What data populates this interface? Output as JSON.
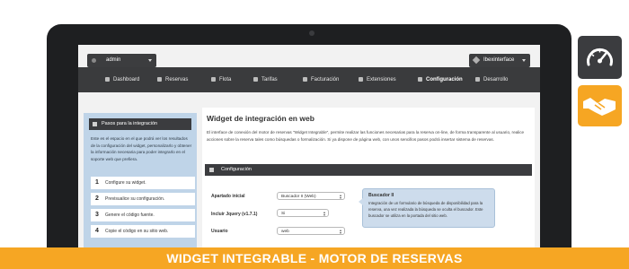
{
  "header": {
    "user_label": "admin",
    "account_label": "Ibexinterface"
  },
  "nav": {
    "items": [
      {
        "label": "Dashboard"
      },
      {
        "label": "Reservas"
      },
      {
        "label": "Flota"
      },
      {
        "label": "Tarifas"
      },
      {
        "label": "Facturación"
      },
      {
        "label": "Extensiones"
      },
      {
        "label": "Configuración"
      },
      {
        "label": "Desarrollo"
      }
    ],
    "active": "Configuración"
  },
  "sidebar": {
    "title": "Pasos para la integración",
    "intro": "Este es el espacio en el que podrá ver los resultados de la configuración del widget, personalizarlo y obtener la información necesaria para poder integrarlo en el soporte web que prefiera.",
    "steps": [
      {
        "number": "1",
        "label": "Configure su widget."
      },
      {
        "number": "2",
        "label": "Previsualice su configuración."
      },
      {
        "number": "3",
        "label": "Genere el código fuente."
      },
      {
        "number": "4",
        "label": "Copie el código en su sitio web."
      }
    ]
  },
  "main": {
    "title": "Widget de integración en web",
    "description": "El interface de conexión del motor de reservas \"Widget Integrable\", permite realizar las funciones necesarias para la reserva on-line, de forma transparente al usuario, realice acciones sobre la reserva tales como búsquedas o formalización. Si ya dispone de página web, con unos sencillos pasos podrá insertar sistema de reservas.",
    "config_title": "Configuración",
    "fields": [
      {
        "label": "Apartado inicial",
        "value": "Buscador II (Web)"
      },
      {
        "label": "Incluir Jquery (v1.7.1)",
        "value": "Si"
      },
      {
        "label": "Usuario",
        "value": "web"
      }
    ],
    "tooltip": {
      "title": "Buscador II",
      "body": "Integración de un formulario de búsqueda de disponibilidad para la reserva, una vez realizada la búsqueda se oculta el buscador. Este buscador se utiliza en la portada del sitio web."
    }
  },
  "side_icons": [
    "gauge-icon",
    "handshake-icon"
  ],
  "banner": {
    "text": "WIDGET INTEGRABLE - MOTOR DE RESERVAS"
  },
  "colors": {
    "accent": "#f6a623",
    "dark": "#3b3c3f",
    "sidebar": "#bfd4e8"
  }
}
